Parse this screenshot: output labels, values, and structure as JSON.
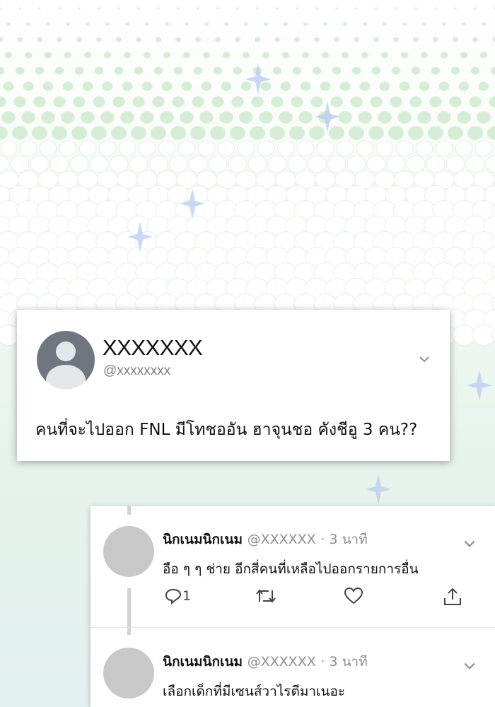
{
  "tweet": {
    "display_name": "XXXXXXX",
    "handle": "@xxxxxxxx",
    "text": "คนที่จะไปออก FNL มีโทชออัน ฮาจุนชอ คังชีอู 3 คน??"
  },
  "replies": [
    {
      "name": "นิกเนมนิกเนม",
      "handle": "@XXXXXX",
      "time": "· 3 นาที",
      "text": "อือ ๆ ๆ ช่าย อีกสี่คนที่เหลือไปออกรายการอื่น",
      "reply_count": "1"
    },
    {
      "name": "นิกเนมนิกเนม",
      "handle": "@XXXXXX",
      "time": "· 3 นาที",
      "text": "เลือกเด็กที่มีเซนส์วาไรตีมาเนอะ"
    }
  ],
  "icons": [
    "chevron-down-icon",
    "reply-icon",
    "retweet-icon",
    "like-icon",
    "share-icon"
  ],
  "colors": {
    "avatar_dark": "#6f7680",
    "avatar_light": "#c8c8c8",
    "muted": "#8a8f94",
    "sparkle": "#b8c8f0"
  }
}
